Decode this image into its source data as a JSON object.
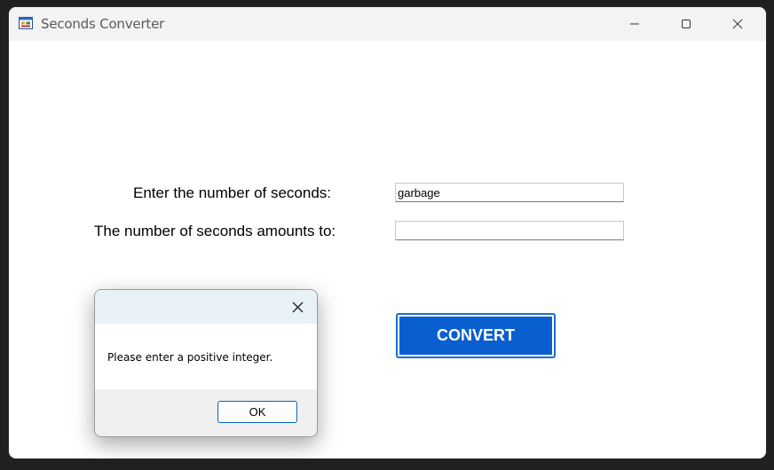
{
  "window": {
    "title": "Seconds Converter",
    "app_icon": "windows-form-icon",
    "controls": {
      "minimize": "minimize-icon",
      "maximize": "maximize-icon",
      "close": "close-icon"
    }
  },
  "form": {
    "seconds_label": "Enter the number of seconds:",
    "seconds_value": "garbage",
    "result_label": "The number of seconds amounts to:",
    "result_value": "",
    "convert_label": "CONVERT"
  },
  "message_box": {
    "message": "Please enter a positive integer.",
    "ok_label": "OK",
    "close_icon": "close-icon"
  },
  "colors": {
    "accent": "#0a5fd0",
    "titlebar": "#f3f3f3",
    "msgbox_title": "#e8f1f5"
  }
}
